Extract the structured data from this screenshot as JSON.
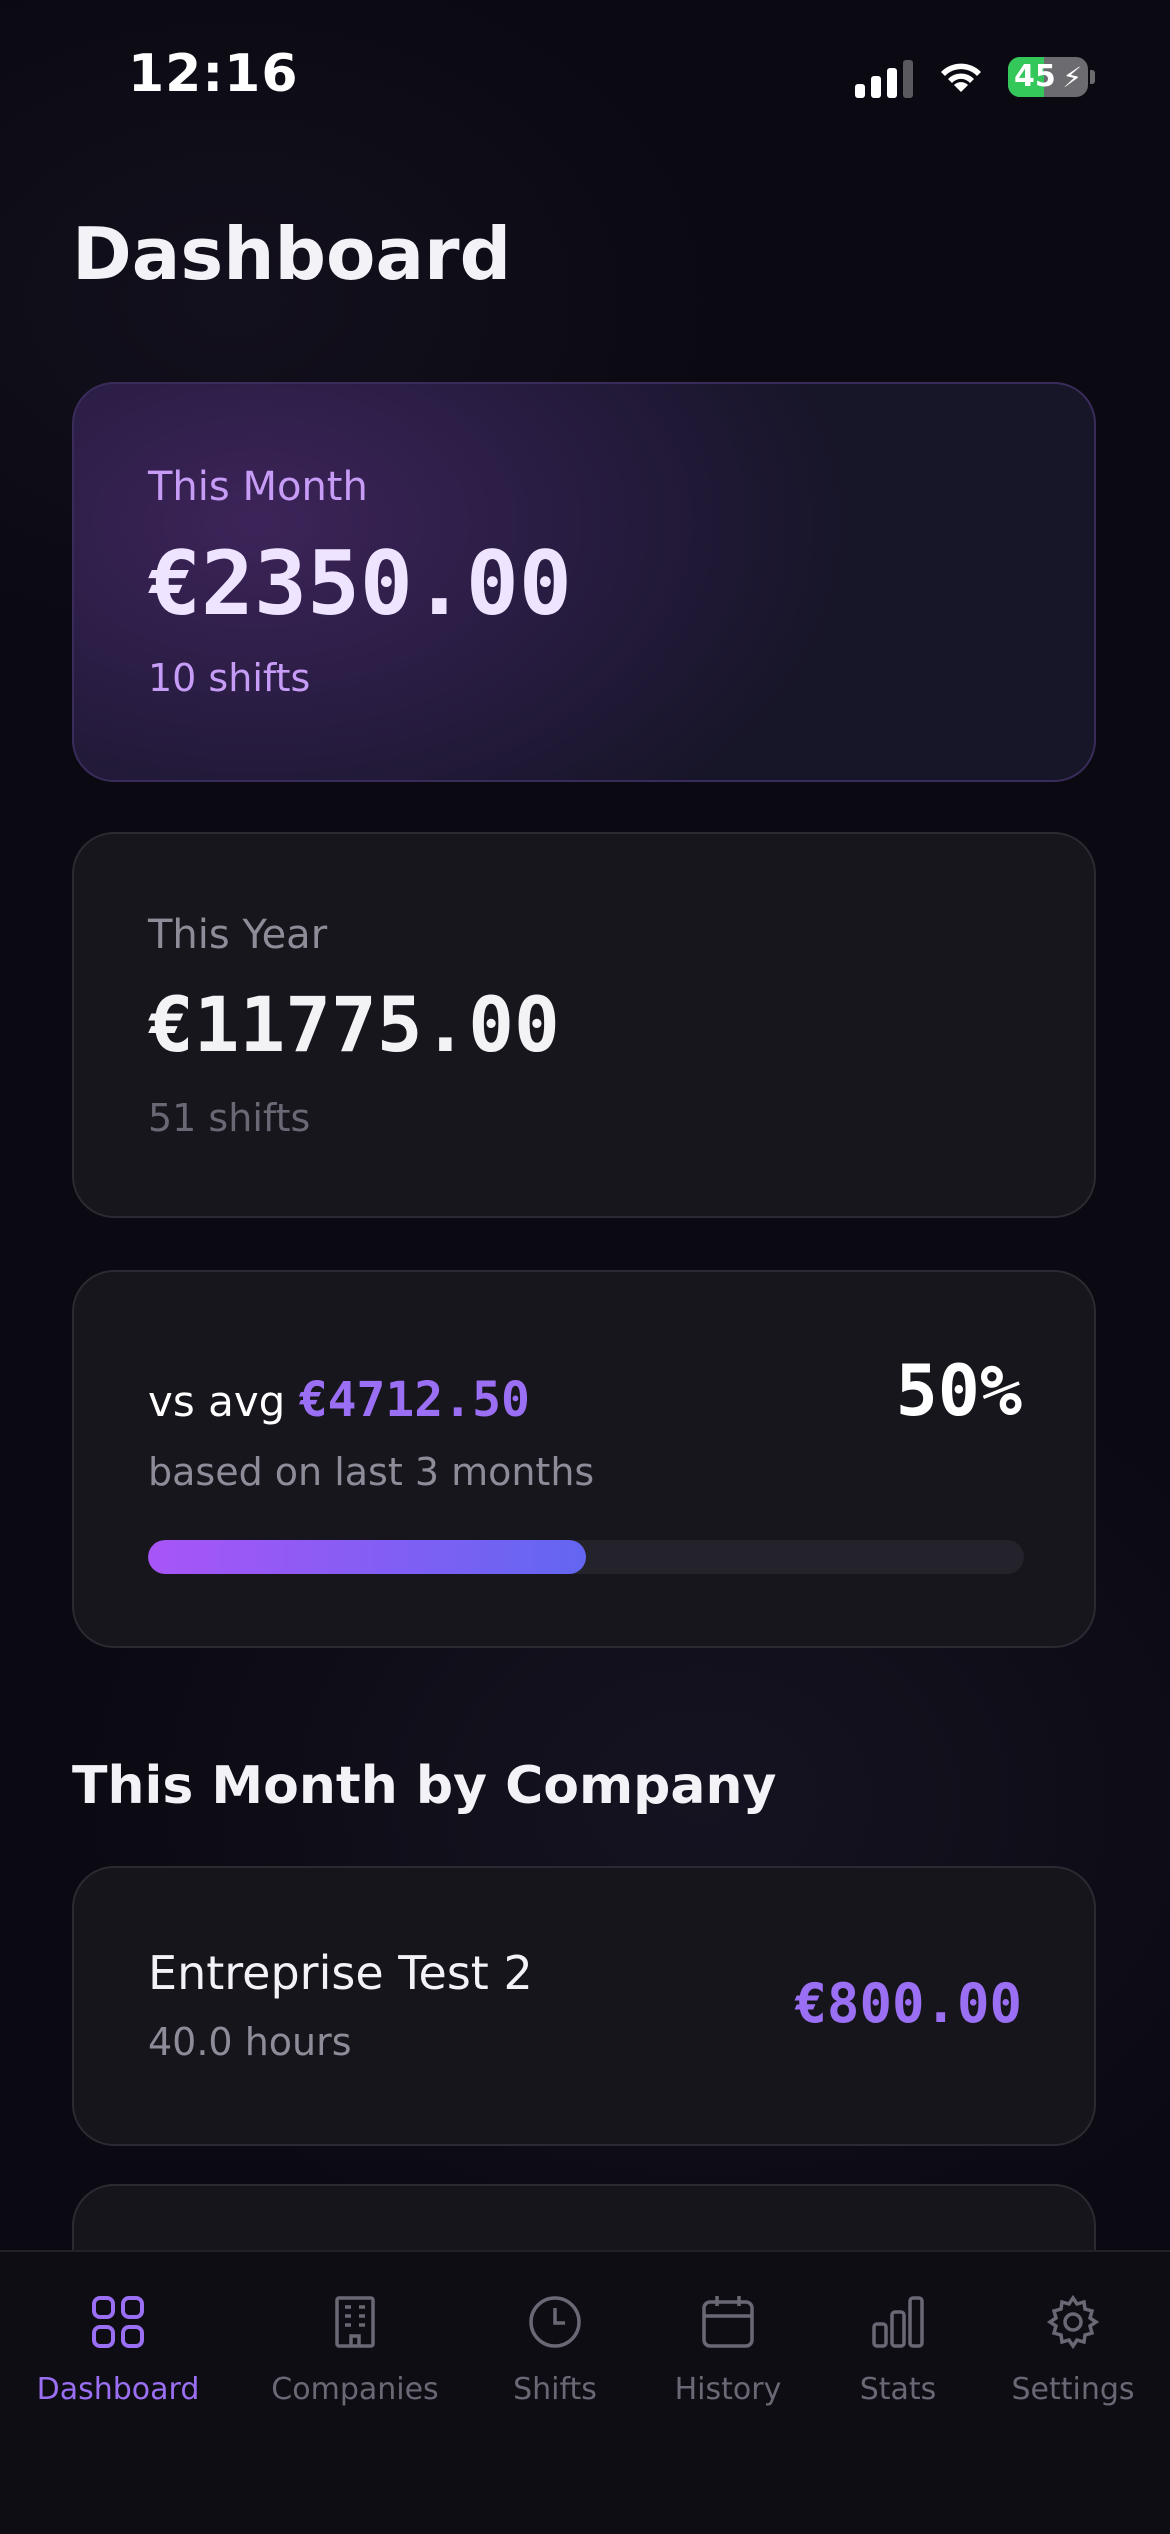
{
  "status_bar": {
    "time": "12:16",
    "battery": "45",
    "battery_level": 0.45
  },
  "page": {
    "title": "Dashboard"
  },
  "this_month": {
    "label": "This Month",
    "amount": "€2350.00",
    "shifts": "10 shifts"
  },
  "this_year": {
    "label": "This Year",
    "amount": "€11775.00",
    "shifts": "51 shifts"
  },
  "vs_avg": {
    "prefix": "vs avg ",
    "value": "€4712.50",
    "percent": "50%",
    "percent_value": 50,
    "subtitle": "based on last 3 months"
  },
  "by_company": {
    "title": "This Month by Company",
    "items": [
      {
        "name": "Entreprise Test 2",
        "hours": "40.0 hours",
        "amount": "€800.00"
      }
    ]
  },
  "tabs": [
    {
      "label": "Dashboard",
      "icon": "grid-icon",
      "active": true
    },
    {
      "label": "Companies",
      "icon": "building-icon",
      "active": false
    },
    {
      "label": "Shifts",
      "icon": "clock-icon",
      "active": false
    },
    {
      "label": "History",
      "icon": "calendar-icon",
      "active": false
    },
    {
      "label": "Stats",
      "icon": "bar-chart-icon",
      "active": false
    },
    {
      "label": "Settings",
      "icon": "gear-icon",
      "active": false
    }
  ],
  "colors": {
    "accent": "#9b6ff3",
    "background": "#0b0a12",
    "card": "#17161d",
    "progress_start": "#a855f7",
    "progress_end": "#6366f1"
  }
}
